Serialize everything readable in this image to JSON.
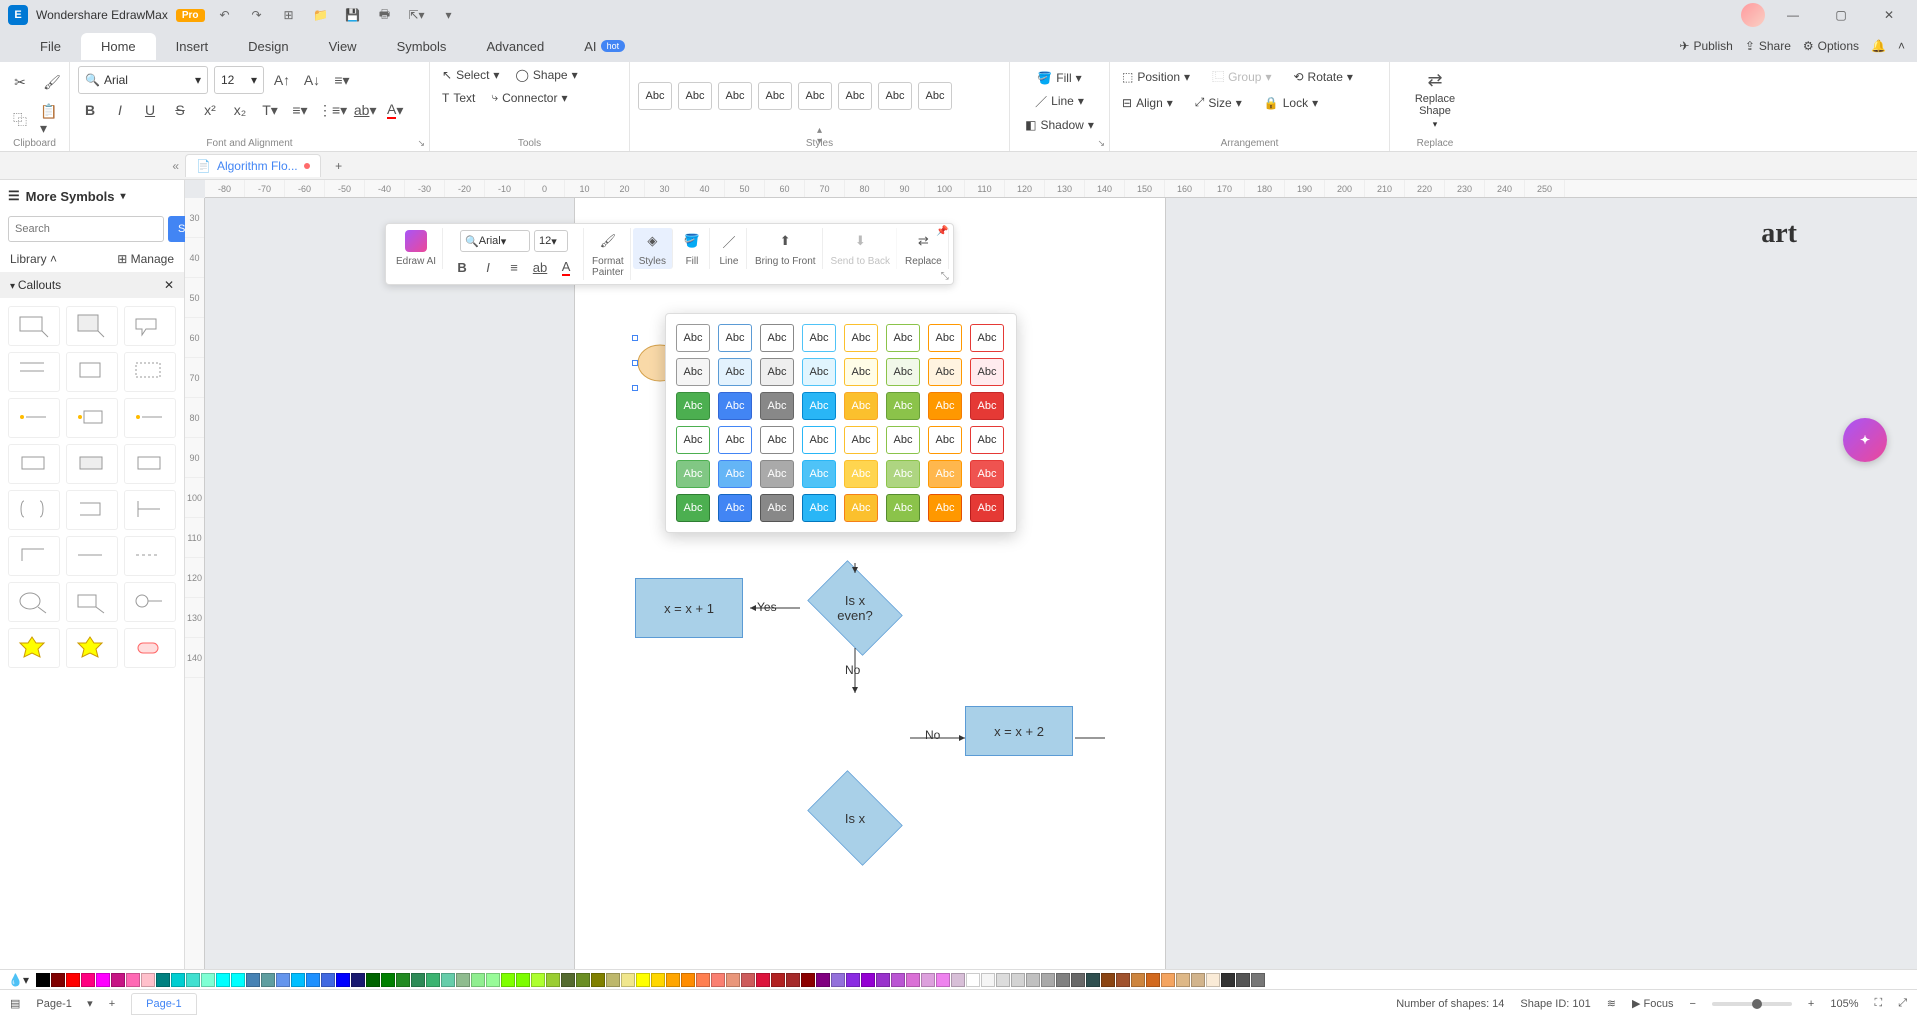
{
  "app": {
    "name": "Wondershare EdrawMax",
    "badge": "Pro"
  },
  "menus": {
    "file": "File",
    "home": "Home",
    "insert": "Insert",
    "design": "Design",
    "view": "View",
    "symbols": "Symbols",
    "advanced": "Advanced",
    "ai": "AI",
    "ai_badge": "hot",
    "publish": "Publish",
    "share": "Share",
    "options": "Options"
  },
  "ribbon": {
    "font_name": "Arial",
    "font_size": "12",
    "select": "Select",
    "shape": "Shape",
    "text": "Text",
    "connector": "Connector",
    "style_label": "Abc",
    "fill": "Fill",
    "line": "Line",
    "shadow": "Shadow",
    "position": "Position",
    "group": "Group",
    "rotate": "Rotate",
    "align": "Align",
    "size": "Size",
    "lock": "Lock",
    "replace_shape": "Replace\nShape",
    "groups": {
      "clipboard": "Clipboard",
      "font": "Font and Alignment",
      "tools": "Tools",
      "styles": "Styles",
      "arrangement": "Arrangement",
      "replace": "Replace"
    }
  },
  "doc_tab": "Algorithm Flo...",
  "sidebar": {
    "title": "More Symbols",
    "search_placeholder": "Search",
    "search_btn": "Search",
    "library": "Library",
    "manage": "Manage",
    "section": "Callouts"
  },
  "ruler_h": [
    "-80",
    "-70",
    "-60",
    "-50",
    "-40",
    "-30",
    "-20",
    "-10",
    "0",
    "10",
    "20",
    "30",
    "40",
    "50",
    "60",
    "70",
    "80",
    "90",
    "100",
    "110",
    "120",
    "130",
    "140",
    "150",
    "160",
    "170",
    "180",
    "190",
    "200",
    "210",
    "220",
    "230",
    "240",
    "250"
  ],
  "ruler_v": [
    "30",
    "40",
    "50",
    "60",
    "70",
    "80",
    "90",
    "100",
    "110",
    "120",
    "130",
    "140"
  ],
  "float": {
    "edraw_ai": "Edraw AI",
    "font": "Arial",
    "size": "12",
    "format_painter": "Format\nPainter",
    "styles": "Styles",
    "fill": "Fill",
    "line": "Line",
    "bring_front": "Bring to Front",
    "send_back": "Send to Back",
    "replace": "Replace"
  },
  "styles_grid": [
    [
      {
        "bg": "#fff",
        "bd": "#999"
      },
      {
        "bg": "#fff",
        "bd": "#5b9bd5"
      },
      {
        "bg": "#fff",
        "bd": "#888"
      },
      {
        "bg": "#fff",
        "bd": "#4fc3f7"
      },
      {
        "bg": "#fff",
        "bd": "#fbc02d"
      },
      {
        "bg": "#fff",
        "bd": "#8bc34a"
      },
      {
        "bg": "#fff",
        "bd": "#ff9800"
      },
      {
        "bg": "#fff",
        "bd": "#e53935"
      }
    ],
    [
      {
        "bg": "#f5f5f5",
        "bd": "#999"
      },
      {
        "bg": "#e3f2fd",
        "bd": "#5b9bd5"
      },
      {
        "bg": "#eee",
        "bd": "#888"
      },
      {
        "bg": "#e1f5fe",
        "bd": "#4fc3f7"
      },
      {
        "bg": "#fffde7",
        "bd": "#fbc02d"
      },
      {
        "bg": "#f1f8e9",
        "bd": "#8bc34a"
      },
      {
        "bg": "#fff3e0",
        "bd": "#ff9800"
      },
      {
        "bg": "#ffebee",
        "bd": "#e53935"
      }
    ],
    [
      {
        "bg": "#4caf50",
        "bd": "#388e3c",
        "fg": "#fff"
      },
      {
        "bg": "#4285f4",
        "bd": "#3367d6",
        "fg": "#fff"
      },
      {
        "bg": "#888",
        "bd": "#666",
        "fg": "#fff"
      },
      {
        "bg": "#29b6f6",
        "bd": "#0288d1",
        "fg": "#fff"
      },
      {
        "bg": "#fbc02d",
        "bd": "#f9a825",
        "fg": "#fff"
      },
      {
        "bg": "#8bc34a",
        "bd": "#689f38",
        "fg": "#fff"
      },
      {
        "bg": "#ff9800",
        "bd": "#f57c00",
        "fg": "#fff"
      },
      {
        "bg": "#e53935",
        "bd": "#c62828",
        "fg": "#fff"
      }
    ],
    [
      {
        "bg": "#fff",
        "bd": "#4caf50"
      },
      {
        "bg": "#fff",
        "bd": "#4285f4"
      },
      {
        "bg": "#fff",
        "bd": "#888"
      },
      {
        "bg": "#fff",
        "bd": "#29b6f6"
      },
      {
        "bg": "#fff",
        "bd": "#fbc02d"
      },
      {
        "bg": "#fff",
        "bd": "#8bc34a"
      },
      {
        "bg": "#fff",
        "bd": "#ff9800"
      },
      {
        "bg": "#fff",
        "bd": "#e53935"
      }
    ],
    [
      {
        "bg": "#81c784",
        "bd": "#4caf50",
        "fg": "#fff"
      },
      {
        "bg": "#64b5f6",
        "bd": "#4285f4",
        "fg": "#fff"
      },
      {
        "bg": "#aaa",
        "bd": "#888",
        "fg": "#fff"
      },
      {
        "bg": "#4fc3f7",
        "bd": "#29b6f6",
        "fg": "#fff"
      },
      {
        "bg": "#ffd54f",
        "bd": "#fbc02d",
        "fg": "#fff"
      },
      {
        "bg": "#aed581",
        "bd": "#8bc34a",
        "fg": "#fff"
      },
      {
        "bg": "#ffb74d",
        "bd": "#ff9800",
        "fg": "#fff"
      },
      {
        "bg": "#ef5350",
        "bd": "#e53935",
        "fg": "#fff"
      }
    ],
    [
      {
        "bg": "#4caf50",
        "bd": "#2e7d32",
        "fg": "#fff"
      },
      {
        "bg": "#4285f4",
        "bd": "#1565c0",
        "fg": "#fff"
      },
      {
        "bg": "#888",
        "bd": "#555",
        "fg": "#fff"
      },
      {
        "bg": "#29b6f6",
        "bd": "#0277bd",
        "fg": "#fff"
      },
      {
        "bg": "#fbc02d",
        "bd": "#f57f17",
        "fg": "#fff"
      },
      {
        "bg": "#8bc34a",
        "bd": "#558b2f",
        "fg": "#fff"
      },
      {
        "bg": "#ff9800",
        "bd": "#e65100",
        "fg": "#fff"
      },
      {
        "bg": "#e53935",
        "bd": "#b71c1c",
        "fg": "#fff"
      }
    ]
  ],
  "flowchart": {
    "title_suffix": "art",
    "box_eq": "x = x + 1",
    "yes": "Yes",
    "no": "No",
    "d1": "Is x\neven?",
    "d2": "Is x",
    "box_eq2": "x = x + 2",
    "no2": "No"
  },
  "colors": [
    "#000",
    "#800000",
    "#f00",
    "#ff0080",
    "#ff00ff",
    "#c71585",
    "#ff69b4",
    "#ffc0cb",
    "#008080",
    "#00ced1",
    "#40e0d0",
    "#7fffd4",
    "#00ffff",
    "#0ff",
    "#4682b4",
    "#5f9ea0",
    "#6495ed",
    "#00bfff",
    "#1e90ff",
    "#4169e1",
    "#00f",
    "#191970",
    "#006400",
    "#008000",
    "#228b22",
    "#2e8b57",
    "#3cb371",
    "#66cdaa",
    "#8fbc8f",
    "#90ee90",
    "#98fb98",
    "#7fff00",
    "#7cfc00",
    "#adff2f",
    "#9acd32",
    "#556b2f",
    "#6b8e23",
    "#808000",
    "#bdb76b",
    "#f0e68c",
    "#ff0",
    "#ffd700",
    "#ffa500",
    "#ff8c00",
    "#ff7f50",
    "#fa8072",
    "#e9967a",
    "#cd5c5c",
    "#dc143c",
    "#b22222",
    "#a52a2a",
    "#8b0000",
    "#800080",
    "#9370db",
    "#8a2be2",
    "#9400d3",
    "#9932cc",
    "#ba55d3",
    "#da70d6",
    "#dda0dd",
    "#ee82ee",
    "#d8bfd8",
    "#fff",
    "#f5f5f5",
    "#dcdcdc",
    "#d3d3d3",
    "#c0c0c0",
    "#a9a9a9",
    "#808080",
    "#696969",
    "#2f4f4f",
    "#8b4513",
    "#a0522d",
    "#cd853f",
    "#d2691e",
    "#f4a460",
    "#deb887",
    "#d2b48c",
    "#faebd7",
    "#333",
    "#555",
    "#777"
  ],
  "status": {
    "page_select": "Page-1",
    "page_tab": "Page-1",
    "shapes": "Number of shapes: 14",
    "shape_id": "Shape ID: 101",
    "focus": "Focus",
    "zoom": "105%"
  }
}
